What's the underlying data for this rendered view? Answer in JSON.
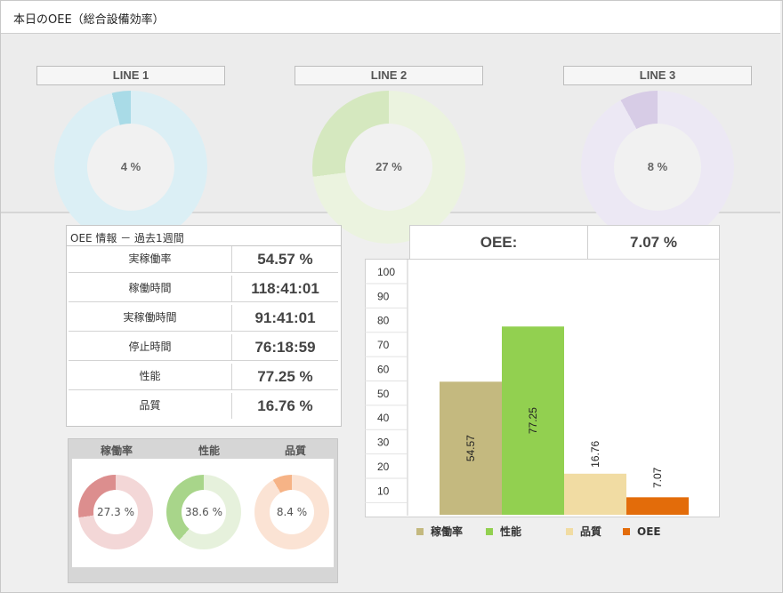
{
  "header": {
    "title": "本日のOEE（総合設備効率）"
  },
  "lines": [
    {
      "label": "LINE 1",
      "percent_text": "4 %",
      "value": 4,
      "fg": "#a9dbe7",
      "bg": "#dbeff5"
    },
    {
      "label": "LINE 2",
      "percent_text": "27 %",
      "value": 27,
      "fg": "#d5e8bf",
      "bg": "#ebf3df"
    },
    {
      "label": "LINE 3",
      "percent_text": "8 %",
      "value": 8,
      "fg": "#d7cce6",
      "bg": "#ece8f4"
    }
  ],
  "info_table": {
    "caption": "OEE 情報 － 過去1週間",
    "rows": [
      {
        "label": "実稼働率",
        "value": "54.57 %"
      },
      {
        "label": "稼働時間",
        "value": "118:41:01"
      },
      {
        "label": "実稼働時間",
        "value": "91:41:01"
      },
      {
        "label": "停止時間",
        "value": "76:18:59"
      },
      {
        "label": "性能",
        "value": "77.25 %"
      },
      {
        "label": "品質",
        "value": "16.76 %"
      }
    ]
  },
  "mini_charts": [
    {
      "label": "稼働率",
      "percent_text": "27.3 %",
      "value": 27.3,
      "fg": "#dc8e8e",
      "bg": "#f3d7d7"
    },
    {
      "label": "性能",
      "percent_text": "38.6 %",
      "value": 38.6,
      "fg": "#a8d58a",
      "bg": "#e6f1dc"
    },
    {
      "label": "品質",
      "percent_text": "8.4 %",
      "value": 8.4,
      "fg": "#f6b386",
      "bg": "#fbe3d4"
    }
  ],
  "oee_summary": {
    "label": "OEE:",
    "value": "7.07 %"
  },
  "chart_data": {
    "type": "bar",
    "categories": [
      "稼働率",
      "性能",
      "品質",
      "OEE"
    ],
    "values": [
      54.57,
      77.25,
      16.76,
      7.07
    ],
    "value_labels": [
      "54.57",
      "77.25",
      "16.76",
      "7.07"
    ],
    "colors": [
      "#c4b97f",
      "#92d050",
      "#f1dca3",
      "#e36c0a"
    ],
    "ylim": [
      5,
      100
    ],
    "yticks": [
      10,
      20,
      30,
      40,
      50,
      60,
      70,
      80,
      90,
      100
    ],
    "grid": false,
    "legend_position": "bottom"
  }
}
